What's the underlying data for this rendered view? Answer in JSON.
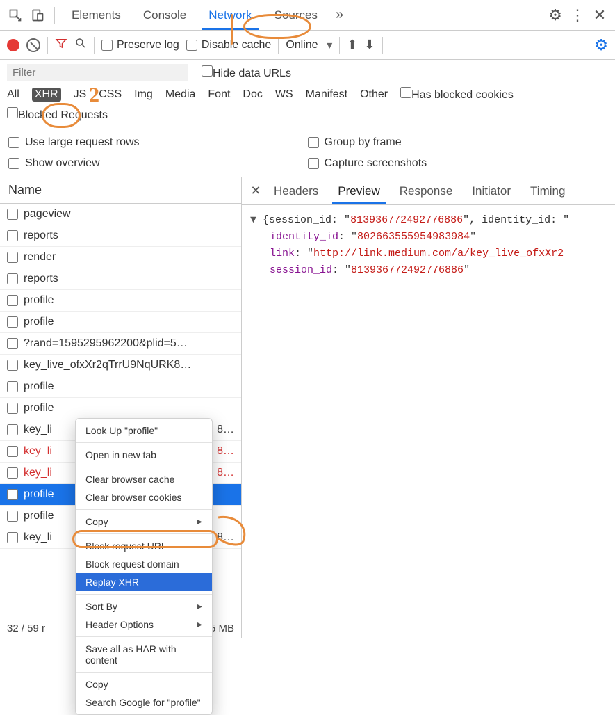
{
  "tabs": {
    "elements": "Elements",
    "console": "Console",
    "network": "Network",
    "sources": "Sources"
  },
  "toolbar": {
    "preserve_log": "Preserve log",
    "disable_cache": "Disable cache",
    "throttling": "Online"
  },
  "filterbar": {
    "placeholder": "Filter",
    "hide_data_urls": "Hide data URLs",
    "types": [
      "All",
      "XHR",
      "JS",
      "CSS",
      "Img",
      "Media",
      "Font",
      "Doc",
      "WS",
      "Manifest",
      "Other"
    ],
    "has_blocked": "Has blocked cookies",
    "blocked_requests": "Blocked Requests"
  },
  "opts": {
    "large_rows": "Use large request rows",
    "show_overview": "Show overview",
    "group_by_frame": "Group by frame",
    "capture_screenshots": "Capture screenshots"
  },
  "left": {
    "header": "Name",
    "items": [
      {
        "label": "pageview"
      },
      {
        "label": "reports"
      },
      {
        "label": "render"
      },
      {
        "label": "reports"
      },
      {
        "label": "profile"
      },
      {
        "label": "profile"
      },
      {
        "label": "?rand=1595295962200&plid=5…"
      },
      {
        "label": "key_live_ofxXr2qTrrU9NqURK8…"
      },
      {
        "label": "profile"
      },
      {
        "label": "profile"
      },
      {
        "label": "key_li"
      },
      {
        "label": "key_li"
      },
      {
        "label": "key_li"
      },
      {
        "label": "profile"
      },
      {
        "label": "profile"
      },
      {
        "label": "key_li"
      }
    ],
    "status": "32 / 59 r",
    "status_tail": "5 MB",
    "tail_suffix": "8…"
  },
  "right": {
    "tabs": {
      "headers": "Headers",
      "preview": "Preview",
      "response": "Response",
      "initiator": "Initiator",
      "timing": "Timing"
    },
    "preview": {
      "line1_a": "{session_id: ",
      "line1_b": "813936772492776886",
      "line1_c": ", identity_id: ",
      "k_identity": "identity_id",
      "v_identity": "802663555954983984",
      "k_link": "link",
      "v_link": "http://link.medium.com/a/key_live_ofxXr2",
      "k_session": "session_id",
      "v_session": "813936772492776886"
    }
  },
  "ctx": {
    "lookup": "Look Up \"profile\"",
    "open_new_tab": "Open in new tab",
    "clear_cache": "Clear browser cache",
    "clear_cookies": "Clear browser cookies",
    "copy": "Copy",
    "block_url": "Block request URL",
    "block_domain": "Block request domain",
    "replay_xhr": "Replay XHR",
    "sort_by": "Sort By",
    "header_options": "Header Options",
    "save_har": "Save all as HAR with content",
    "copy2": "Copy",
    "search_google": "Search Google for \"profile\""
  },
  "ann": {
    "two": "2"
  }
}
